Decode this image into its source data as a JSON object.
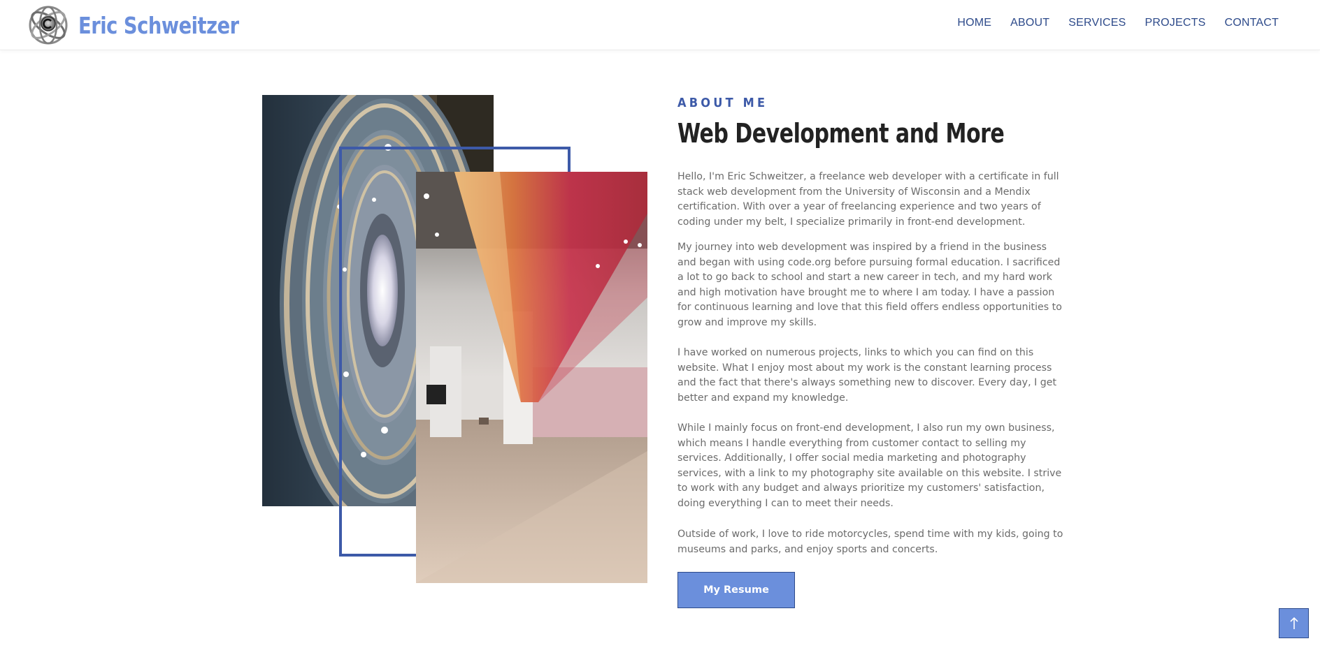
{
  "brand": {
    "name": "Eric Schweitzer",
    "logo_icon": "atom-orbit-logo-icon"
  },
  "nav": {
    "items": [
      {
        "label": "HOME"
      },
      {
        "label": "ABOUT"
      },
      {
        "label": "SERVICES"
      },
      {
        "label": "PROJECTS"
      },
      {
        "label": "CONTACT"
      }
    ]
  },
  "about": {
    "eyebrow": "ABOUT ME",
    "title": "Web Development and More",
    "paragraphs": [
      "Hello, I'm Eric Schweitzer, a freelance web developer with a certificate in full stack web development from the University of Wisconsin and a Mendix certification. With over a year of freelancing experience and two years of coding under my belt, I specialize primarily in front-end development.",
      "My journey into web development was inspired by a friend in the business and began with using code.org before pursuing formal education. I sacrificed a lot to go back to school and start a new career in tech, and my hard work and high motivation have brought me to where I am today. I have a passion for continuous learning and love that this field offers endless opportunities to grow and improve my skills.",
      "I have worked on numerous projects, links to which you can find on this website. What I enjoy most about my work is the constant learning process and the fact that there's always something new to discover. Every day, I get better and expand my knowledge.",
      "While I mainly focus on front-end development, I also run my own business, which means I handle everything from customer contact to selling my services. Additionally, I offer social media marketing and photography services, with a link to my photography site available on this website. I strive to work with any budget and always prioritize my customers' satisfaction, doing everything I can to meet their needs.",
      "Outside of work, I love to ride motorcycles, spend time with my kids, going to museums and parks, and enjoy sports and concerts."
    ],
    "resume_button": "My Resume"
  },
  "back_to_top": {
    "icon": "arrow-up-icon"
  },
  "colors": {
    "accent": "#6b8fdc",
    "nav": "#2d4a8a",
    "frame": "#3d5aa8",
    "heading": "#222222",
    "body_text": "#6b6b6b"
  }
}
